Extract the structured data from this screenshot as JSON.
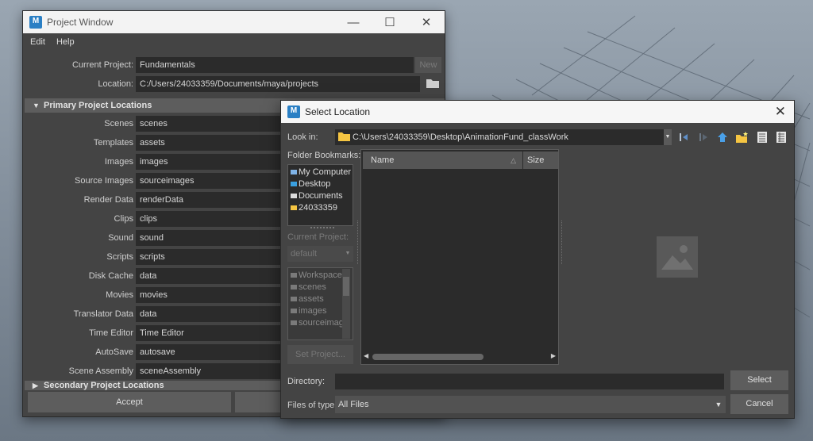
{
  "project_window": {
    "title": "Project Window",
    "menu": [
      "Edit",
      "Help"
    ],
    "current_project_label": "Current Project:",
    "current_project_value": "Fundamentals",
    "new_button": "New",
    "location_label": "Location:",
    "location_value": "C:/Users/24033359/Documents/maya/projects",
    "primary_section_label": "Primary Project Locations",
    "rows": [
      {
        "label": "Scenes",
        "value": "scenes"
      },
      {
        "label": "Templates",
        "value": "assets"
      },
      {
        "label": "Images",
        "value": "images"
      },
      {
        "label": "Source Images",
        "value": "sourceimages"
      },
      {
        "label": "Render Data",
        "value": "renderData"
      },
      {
        "label": "Clips",
        "value": "clips"
      },
      {
        "label": "Sound",
        "value": "sound"
      },
      {
        "label": "Scripts",
        "value": "scripts"
      },
      {
        "label": "Disk Cache",
        "value": "data"
      },
      {
        "label": "Movies",
        "value": "movies"
      },
      {
        "label": "Translator Data",
        "value": "data"
      },
      {
        "label": "Time Editor",
        "value": "Time Editor"
      },
      {
        "label": "AutoSave",
        "value": "autosave"
      },
      {
        "label": "Scene Assembly",
        "value": "sceneAssembly"
      }
    ],
    "secondary_section_label": "Secondary Project Locations",
    "accept_button": "Accept"
  },
  "select_location": {
    "title": "Select Location",
    "look_in_label": "Look in:",
    "look_in_value": "C:\\Users\\24033359\\Desktop\\AnimationFund_classWork",
    "toolbar_icons": [
      "back-icon",
      "forward-icon",
      "parent-folder-icon",
      "new-folder-icon",
      "list-view-icon",
      "detail-view-icon"
    ],
    "folder_bookmarks_label": "Folder Bookmarks:",
    "bookmarks": [
      {
        "label": "My Computer",
        "icon": "computer-icon"
      },
      {
        "label": "Desktop",
        "icon": "desktop-icon"
      },
      {
        "label": "Documents",
        "icon": "document-icon"
      },
      {
        "label": "24033359",
        "icon": "folder-icon"
      }
    ],
    "current_project_label": "Current Project:",
    "current_project_value": "default",
    "project_folders": [
      "Workspace R...",
      "scenes",
      "assets",
      "images",
      "sourceimage"
    ],
    "set_project_button": "Set Project...",
    "columns": [
      "Name",
      "Size"
    ],
    "directory_label": "Directory:",
    "directory_value": "",
    "files_of_type_label": "Files of type:",
    "files_of_type_value": "All Files",
    "select_button": "Select",
    "cancel_button": "Cancel"
  },
  "colors": {
    "panel": "#444444",
    "field": "#2b2b2b",
    "folder_yellow": "#f5c542",
    "accent_blue": "#2a7fc4"
  }
}
